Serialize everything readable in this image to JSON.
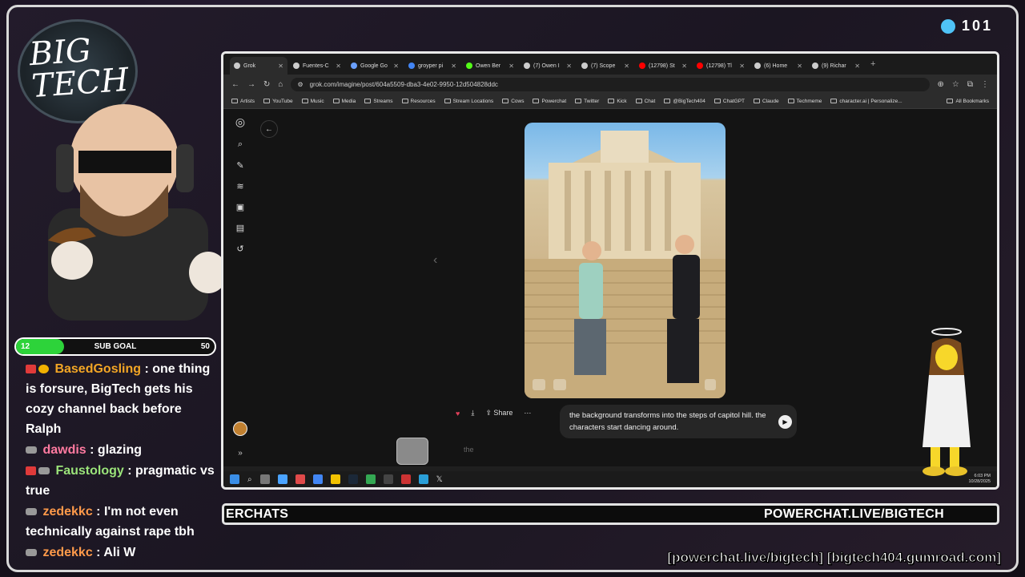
{
  "overlay": {
    "viewer_count": "101",
    "logo_text": "BIG TECH",
    "sub_goal": {
      "label": "SUB GOAL",
      "current": "12",
      "target": "50",
      "progress": 0.24
    },
    "ticker_left": "ERCHATS",
    "ticker_right": "POWERCHAT.LIVE/BIGTECH",
    "footer_links": "[powerchat.live/bigtech] [bigtech404.gumroad.com]"
  },
  "chat": [
    {
      "user": "BasedGosling",
      "text": ": one thing is forsure, BigTech gets his cozy channel back before Ralph",
      "color": "#f3a625"
    },
    {
      "user": "dawdis",
      "text": ": glazing",
      "color": "#ff7aa0"
    },
    {
      "user": "Faustology",
      "text": ": pragmatic vs true",
      "color": "#9be47a"
    },
    {
      "user": "zedekkc",
      "text": ": I'm not even technically against rape tbh",
      "color": "#ff9a4a"
    },
    {
      "user": "zedekkc",
      "text": ": Ali W",
      "color": "#ff9a4a"
    }
  ],
  "browser": {
    "tabs": [
      {
        "label": "Grok",
        "active": true
      },
      {
        "label": "Fuentes-C"
      },
      {
        "label": "Google Go"
      },
      {
        "label": "groyper pi"
      },
      {
        "label": "Owen Ber"
      },
      {
        "label": "(7) Owen I"
      },
      {
        "label": "(7) Scope"
      },
      {
        "label": "(12798) St"
      },
      {
        "label": "(12798) Tl"
      },
      {
        "label": "(6) Home"
      },
      {
        "label": "(9) Richar"
      }
    ],
    "url": "grok.com/imagine/post/604a5509-dba3-4e02-9950-12d504828ddc",
    "bookmarks": [
      "Artists",
      "YouTube",
      "Music",
      "Media",
      "Streams",
      "Resources",
      "Stream Locations",
      "Cows",
      "Powerchat",
      "Twitter",
      "Kick",
      "Chat",
      "@BigTech404",
      "ChatGPT",
      "Claude",
      "Techmeme",
      "character.ai | Personalize..."
    ],
    "all_bookmarks": "All Bookmarks",
    "share_label": "Share",
    "prompt_text": "the background transforms into the steps of capitol hill. the characters start dancing around.",
    "composer_placeholder": "the",
    "clock_time": "6:03 PM",
    "clock_date": "10/28/2025"
  }
}
